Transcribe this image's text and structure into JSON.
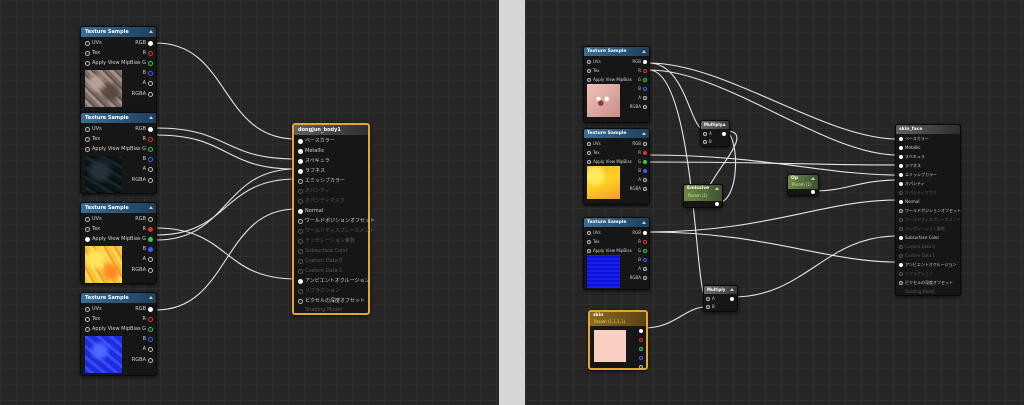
{
  "left_graph": {
    "texture_nodes": [
      {
        "title": "Texture Sample",
        "pins": [
          "UVs",
          "Tex",
          "Apply View MipBias"
        ],
        "outs": [
          "RGB",
          "R",
          "G",
          "B",
          "A",
          "RGBA"
        ],
        "thumb": "rock-texture"
      },
      {
        "title": "Texture Sample",
        "pins": [
          "UVs",
          "Tex",
          "Apply View MipBias"
        ],
        "outs": [
          "RGB",
          "R",
          "G",
          "B",
          "A",
          "RGBA"
        ],
        "thumb": "dark-texture"
      },
      {
        "title": "Texture Sample",
        "pins": [
          "UVs",
          "Tex",
          "Apply View MipBias"
        ],
        "outs": [
          "RGB",
          "R",
          "G",
          "B",
          "A",
          "RGBA"
        ],
        "thumb": "yellow-texture"
      },
      {
        "title": "Texture Sample",
        "pins": [
          "UVs",
          "Tex",
          "Apply View MipBias"
        ],
        "outs": [
          "RGB",
          "R",
          "G",
          "B",
          "A",
          "RGBA"
        ],
        "thumb": "blue-texture"
      }
    ],
    "material_node": {
      "title": "dongjun_body1",
      "pins": [
        "ベースカラー",
        "Metallic",
        "スペキュラ",
        "ラフネス",
        "エミッシブカラー",
        "オパシティ",
        "オパシティマスク",
        "Normal",
        "ワールドポジションオフセット",
        "ワールドディスプレースメント",
        "テッセレーション乗数",
        "Subsurface Color",
        "Custom Data 0",
        "Custom Data 1",
        "アンビエントオクルージョン",
        "リフラクション",
        "ピクセルの深度オフセット",
        "Shading Model"
      ]
    }
  },
  "right_graph": {
    "texture_nodes": [
      {
        "title": "Texture Sample",
        "pins": [
          "UVs",
          "Tex",
          "Apply View MipBias"
        ],
        "outs": [
          "RGB",
          "R",
          "G",
          "B",
          "A",
          "RGBA"
        ],
        "thumb": "face-texture"
      },
      {
        "title": "Texture Sample",
        "pins": [
          "UVs",
          "Tex",
          "Apply View MipBias"
        ],
        "outs": [
          "RGB",
          "R",
          "G",
          "B",
          "A",
          "RGBA"
        ],
        "thumb": "yellow-texture"
      },
      {
        "title": "Texture Sample",
        "pins": [
          "UVs",
          "Tex",
          "Apply View MipBias"
        ],
        "outs": [
          "RGB",
          "R",
          "G",
          "B",
          "A",
          "RGBA"
        ],
        "thumb": "blue-texture"
      }
    ],
    "multiply_top": {
      "title": "Multiply",
      "pins": [
        "A",
        "B"
      ]
    },
    "emissive": {
      "title": "Emissive",
      "sub": "Param (1)"
    },
    "param_small": {
      "title": "Op",
      "sub": "Param (1)"
    },
    "multiply_bottom": {
      "title": "Multiply",
      "pins": [
        "A",
        "B"
      ]
    },
    "color_node": {
      "title": "skin",
      "sub": "Param (1,1,1,1)"
    },
    "material_node": {
      "title": "skin_face",
      "pins": [
        "ベースカラー",
        "Metallic",
        "スペキュラ",
        "ラフネス",
        "エミッシブカラー",
        "オパシティ",
        "オパシティマスク",
        "Normal",
        "ワールドポジションオフセット",
        "ワールドディスプレースメント",
        "テッセレーション乗数",
        "Subsurface Color",
        "Custom Data 0",
        "Custom Data 1",
        "アンビエントオクルージョン",
        "リフラクション",
        "ピクセルの深度オフセット",
        "Shading Model"
      ]
    }
  },
  "colors": {
    "selection": "#e5a531",
    "pin_red": "#e23030",
    "pin_green": "#2fd04a",
    "pin_blue": "#3a5cff",
    "wire": "#e6e6e6",
    "texture_header": "#3a6e95"
  }
}
